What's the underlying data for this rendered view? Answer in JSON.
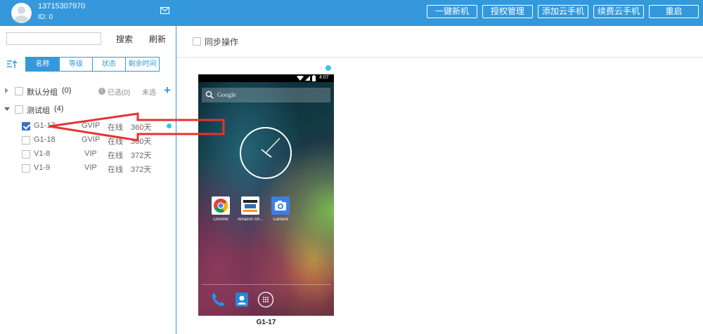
{
  "header": {
    "phone": "13715307970",
    "user_id": "ID: 0",
    "buttons": [
      "一键新机",
      "授权管理",
      "添加云手机",
      "续费云手机",
      "重启"
    ]
  },
  "sidebar": {
    "search_placeholder": "",
    "search_label": "搜索",
    "refresh_label": "刷新",
    "sort_tabs": [
      "名称",
      "等级",
      "状态",
      "剩余时间"
    ],
    "groups": [
      {
        "name": "默认分组",
        "count": "(0)",
        "selected": "已选(0)",
        "unselected": "未选"
      },
      {
        "name": "测试组",
        "count": "(4)"
      }
    ],
    "devices": [
      {
        "name": "G1-17",
        "level": "GVIP",
        "status": "在线",
        "remaining": "360天",
        "checked": true
      },
      {
        "name": "G1-18",
        "level": "GVIP",
        "status": "在线",
        "remaining": "360天",
        "checked": false
      },
      {
        "name": "V1-8",
        "level": "VIP",
        "status": "在线",
        "remaining": "372天",
        "checked": false
      },
      {
        "name": "V1-9",
        "level": "VIP",
        "status": "在线",
        "remaining": "372天",
        "checked": false
      }
    ]
  },
  "main": {
    "sync_label": "同步操作",
    "phone": {
      "name": "G1-17",
      "status_time": "4:07",
      "search_hint": "Google",
      "apps": [
        "Chrome",
        "Amazon Sh...",
        "Camera"
      ]
    }
  },
  "colors": {
    "accent": "#3498db",
    "online_dot": "#2fc9e8",
    "arrow": "#e53333"
  }
}
